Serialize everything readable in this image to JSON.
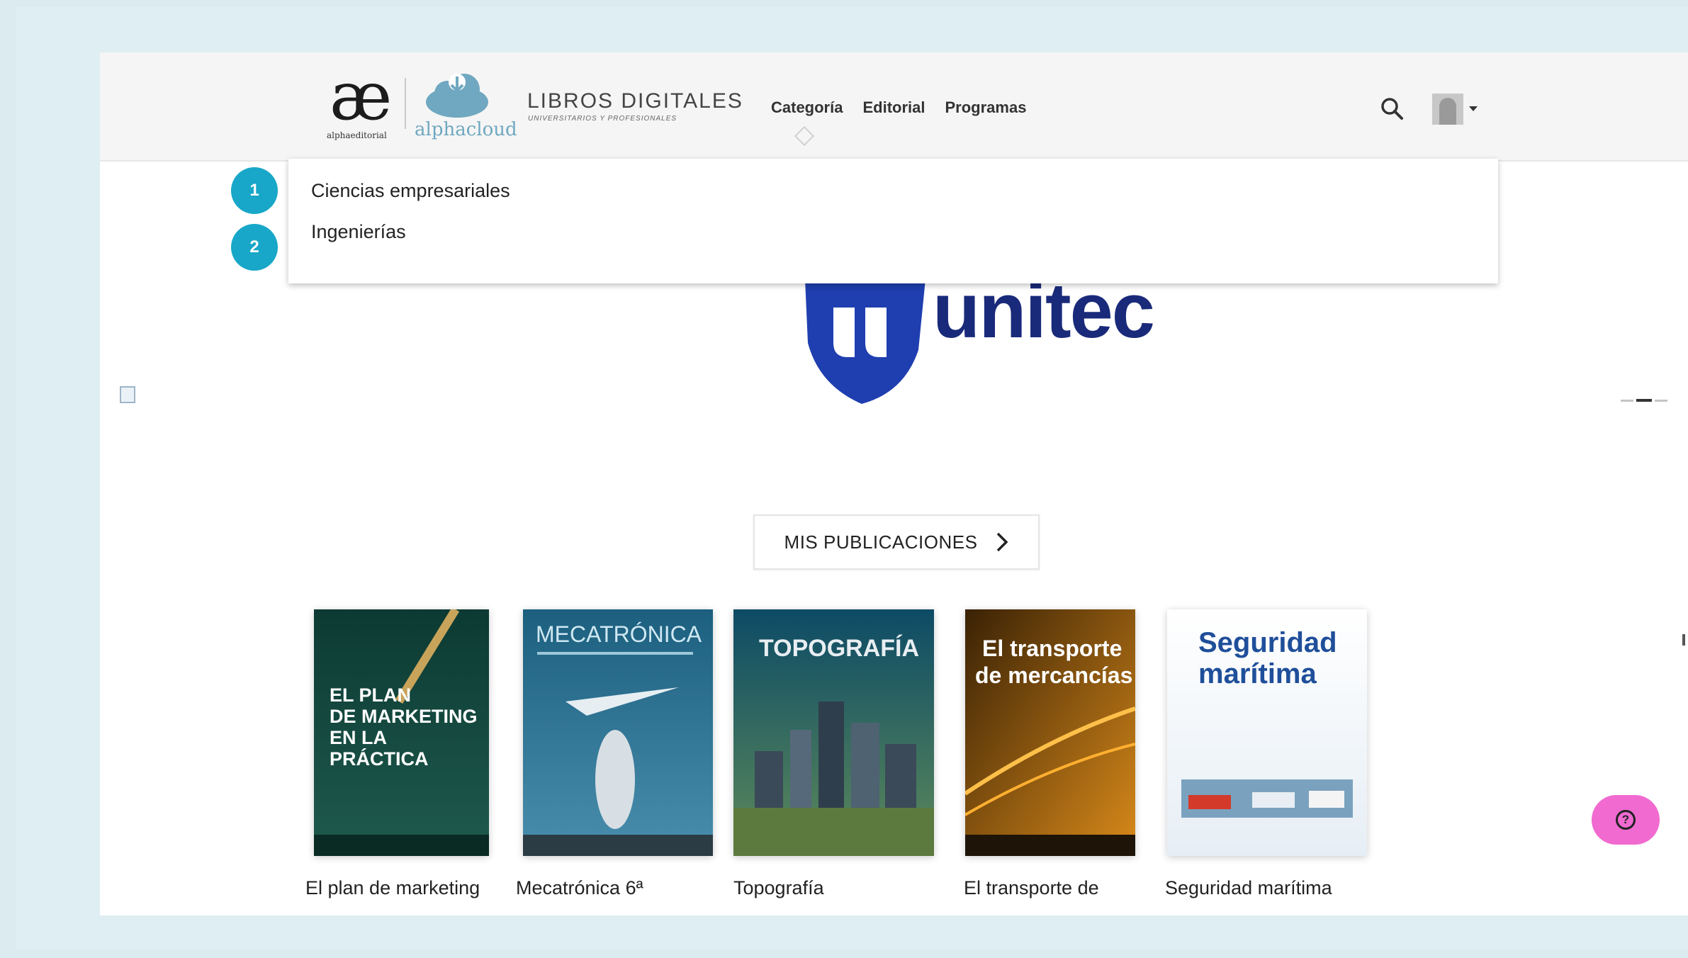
{
  "header": {
    "logo_left_small": "alphaeditorial",
    "logo_cloud_text": "alphacloud",
    "brand_title": "LIBROS DIGITALES",
    "brand_subtitle": "UNIVERSITARIOS Y PROFESIONALES",
    "nav": [
      {
        "label": "Categoría"
      },
      {
        "label": "Editorial"
      },
      {
        "label": "Programas"
      }
    ]
  },
  "dropdown": {
    "items": [
      {
        "label": "Ciencias empresariales",
        "step": "1"
      },
      {
        "label": "Ingenierías",
        "step": "2"
      }
    ]
  },
  "hero": {
    "logo_text": "unitec"
  },
  "mis_publicaciones": {
    "label": "MIS PUBLICACIONES"
  },
  "books": [
    {
      "title": "El plan de marketing",
      "cover_title": "EL PLAN DE MARKETING EN LA PRÁCTICA",
      "colors": [
        "#0c3a33",
        "#1f5a4d"
      ]
    },
    {
      "title": "Mecatrónica 6ª",
      "cover_title": "MECATRÓNICA",
      "colors": [
        "#1c5f7f",
        "#4a8eae"
      ]
    },
    {
      "title": "Topografía",
      "cover_title": "TOPOGRAFÍA",
      "colors": [
        "#0d4b66",
        "#5d8a5a"
      ]
    },
    {
      "title": "El transporte de",
      "cover_title": "El transporte de mercancías",
      "colors": [
        "#3a2205",
        "#d98a1a"
      ]
    },
    {
      "title": "Seguridad marítima",
      "cover_title": "Seguridad marítima",
      "colors": [
        "#ffffff",
        "#e6eef5"
      ]
    }
  ],
  "colors": {
    "accent": "#18a7c8",
    "help_button": "#f06ad0",
    "hero_blue": "#1a2a7a"
  },
  "icons": {
    "search": "search-icon",
    "help": "help-icon",
    "chevron": "chevron-right-icon"
  }
}
